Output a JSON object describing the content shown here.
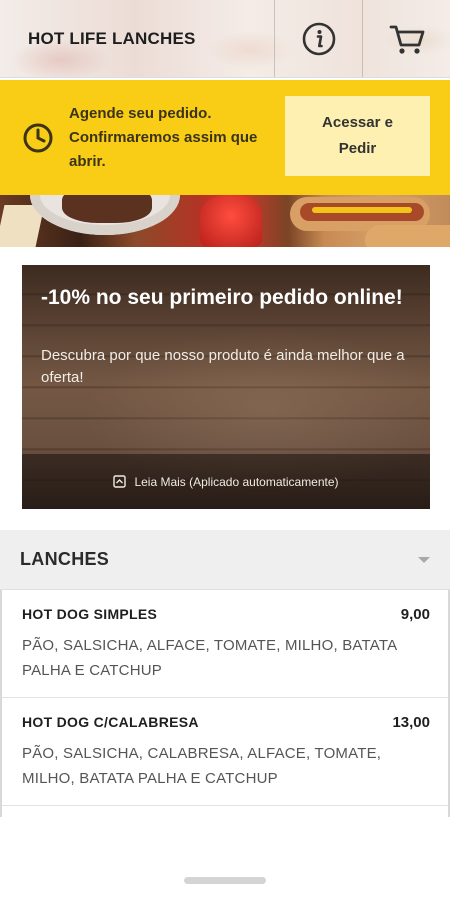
{
  "header": {
    "title": "HOT LIFE LANCHES",
    "info_icon": "info-icon",
    "cart_icon": "cart-icon"
  },
  "schedule": {
    "icon": "clock-icon",
    "message": "Agende seu pedido. Confirmaremos assim que abrir.",
    "button_label": "Acessar e Pedir"
  },
  "promo": {
    "title": "-10% no seu primeiro pedido online!",
    "description": "Descubra por que nosso produto é ainda melhor que a oferta!",
    "footer_icon": "expand-icon",
    "footer_label": "Leia Mais (Aplicado automaticamente)"
  },
  "category": {
    "title": "LANCHES",
    "caret_icon": "chevron-down-icon"
  },
  "menu": {
    "items": [
      {
        "name": "HOT DOG SIMPLES",
        "price": "9,00",
        "description": "PÃO, SALSICHA, ALFACE, TOMATE, MILHO, BATATA PALHA E CATCHUP"
      },
      {
        "name": "HOT DOG C/CALABRESA",
        "price": "13,00",
        "description": "PÃO, SALSICHA, CALABRESA, ALFACE, TOMATE, MILHO, BATATA PALHA E CATCHUP"
      }
    ]
  },
  "colors": {
    "accent_yellow": "#f9cc15",
    "button_light_yellow": "#fdf0b0",
    "category_bg": "#efefef"
  }
}
